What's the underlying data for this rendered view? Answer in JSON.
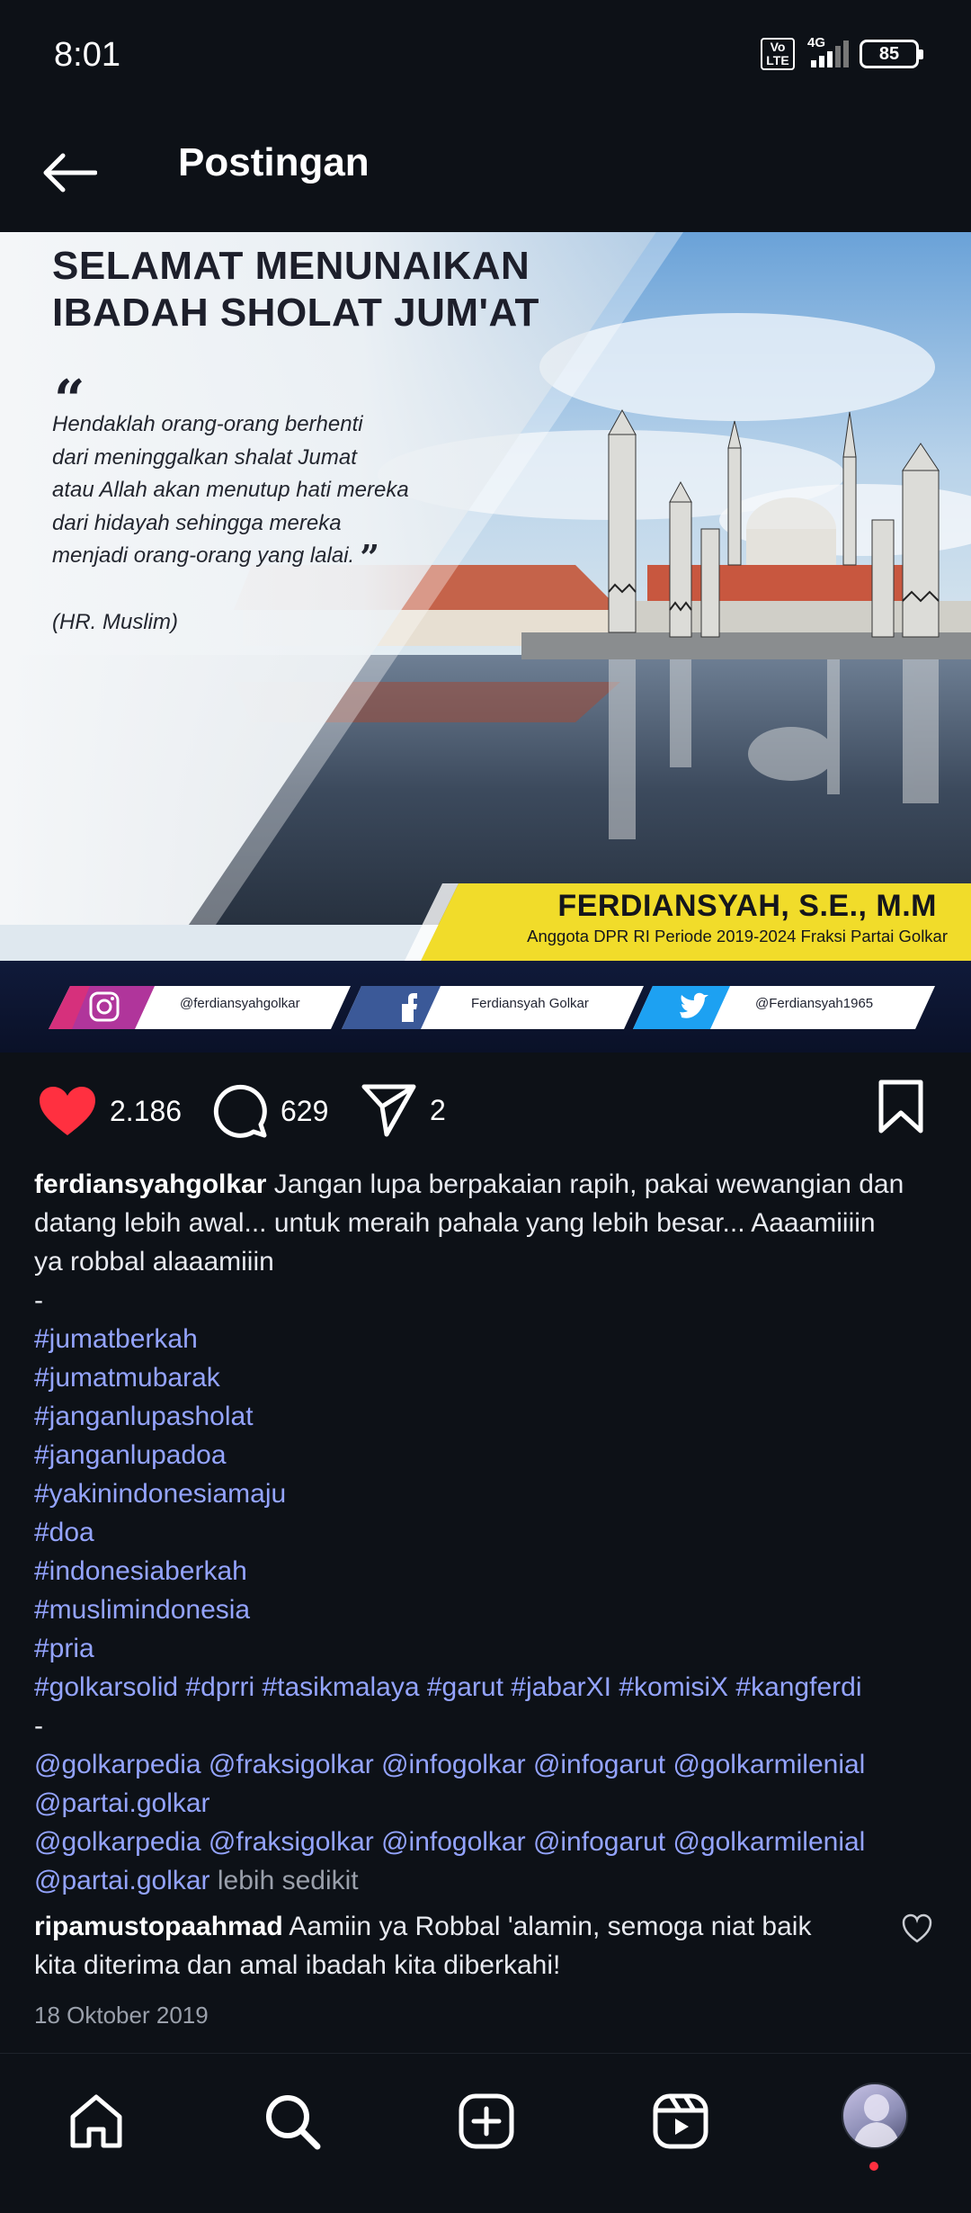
{
  "status_bar": {
    "time": "8:01",
    "volte": "Vo LTE",
    "network": "4G",
    "battery": "85"
  },
  "header": {
    "title": "Postingan"
  },
  "post_image": {
    "headline_line1": "SELAMAT MENUNAIKAN",
    "headline_line2": "IBADAH SHOLAT JUM'AT",
    "quote_open": "“",
    "quote_lines": [
      "Hendaklah orang-orang berhenti",
      "dari meninggalkan shalat Jumat",
      "atau Allah akan menutup hati mereka",
      "dari hidayah sehingga mereka",
      "menjadi orang-orang yang lalai."
    ],
    "quote_close": "”",
    "source": "(HR. Muslim)",
    "name": "FERDIANSYAH, S.E., M.M",
    "position": "Anggota DPR RI Periode 2019-2024 Fraksi Partai Golkar",
    "social_instagram": "@ferdiansyahgolkar",
    "social_facebook": "Ferdiansyah Golkar",
    "social_twitter": "@Ferdiansyah1965"
  },
  "actions": {
    "likes": "2.186",
    "comments": "629",
    "shares": "2"
  },
  "caption": {
    "username": "ferdiansyahgolkar",
    "text": " Jangan lupa berpakaian rapih, pakai wewangian dan",
    "text_line2": "datang lebih awal... untuk meraih pahala yang lebih besar... Aaaamiiiin",
    "text_line3": "ya robbal alaaamiiin",
    "dash": "-",
    "hashtags": [
      "#jumatberkah",
      "#jumatmubarak",
      "#janganlupasholat",
      "#janganlupadoa",
      "#yakinindonesiamaju",
      "#doa",
      "#indonesiaberkah",
      "#muslimindonesia",
      "#pria"
    ],
    "hashtag_row": "#golkarsolid  #dprri #tasikmalaya #garut #jabarXI #komisiX #kangferdi",
    "mentions_line1": "@golkarpedia @fraksigolkar @infogolkar @infogarut  @golkarmilenial",
    "mentions_line2": "@partai.golkar",
    "mentions_line3": "@golkarpedia @fraksigolkar @infogolkar @infogarut  @golkarmilenial",
    "mentions_line4": "@partai.golkar",
    "more": " lebih sedikit"
  },
  "comment": {
    "username": "ripamustopaahmad",
    "text_line1": " Aamiin ya Robbal 'alamin, semoga niat baik",
    "text_line2": "kita diterima dan amal ibadah kita diberkahi!"
  },
  "date": "18 Oktober 2019",
  "colors": {
    "background": "#0d1117",
    "hashtag": "#94a4ff",
    "like": "#ff3040",
    "banner_yellow": "#f1dc2a"
  },
  "bottom_nav": [
    "home-icon",
    "search-icon",
    "create-icon",
    "reels-icon",
    "profile-avatar"
  ]
}
